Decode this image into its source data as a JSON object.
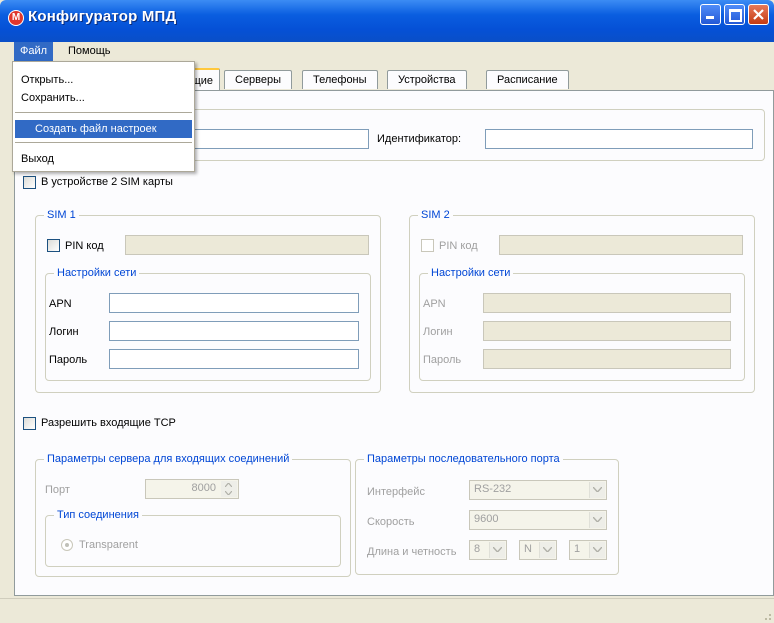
{
  "window": {
    "title": "Конфигуратор МПД",
    "icon_letter": "M"
  },
  "menubar": {
    "file": "Файл",
    "help": "Помощь"
  },
  "file_menu": {
    "open": "Открыть...",
    "save": "Сохранить...",
    "create_settings": "Создать файл настроек",
    "exit": "Выход"
  },
  "tabs": [
    "щие",
    "Серверы",
    "Телефоны",
    "Устройства",
    "Расписание"
  ],
  "device": {
    "identifier_label": "Идентификатор:",
    "identifier_value": "",
    "first_value": ""
  },
  "two_sim": {
    "label": "В устройстве 2 SIM карты",
    "checked": false
  },
  "sim1": {
    "title": "SIM 1",
    "pin_label": "PIN код",
    "pin_value": "",
    "network_title": "Настройки сети",
    "apn_label": "APN",
    "apn_value": "",
    "login_label": "Логин",
    "login_value": "",
    "password_label": "Пароль",
    "password_value": ""
  },
  "sim2": {
    "title": "SIM 2",
    "pin_label": "PIN код",
    "pin_value": "",
    "network_title": "Настройки сети",
    "apn_label": "APN",
    "apn_value": "",
    "login_label": "Логин",
    "login_value": "",
    "password_label": "Пароль",
    "password_value": ""
  },
  "incoming_tcp": {
    "label": "Разрешить входящие TCP",
    "checked": false
  },
  "server_params": {
    "title": "Параметры сервера для входящих соединений",
    "port_label": "Порт",
    "port_value": "8000",
    "conn_type_title": "Тип соединения",
    "transparent_label": "Transparent"
  },
  "serial_params": {
    "title": "Параметры последовательного порта",
    "interface_label": "Интерфейс",
    "interface_value": "RS-232",
    "speed_label": "Скорость",
    "speed_value": "9600",
    "length_parity_label": "Длина и четность",
    "data_bits": "8",
    "parity": "N",
    "stop_bits": "1"
  },
  "colors": {
    "accent": "#316ac5",
    "legend": "#0046d5",
    "titlebar": "#0a5ee0"
  }
}
